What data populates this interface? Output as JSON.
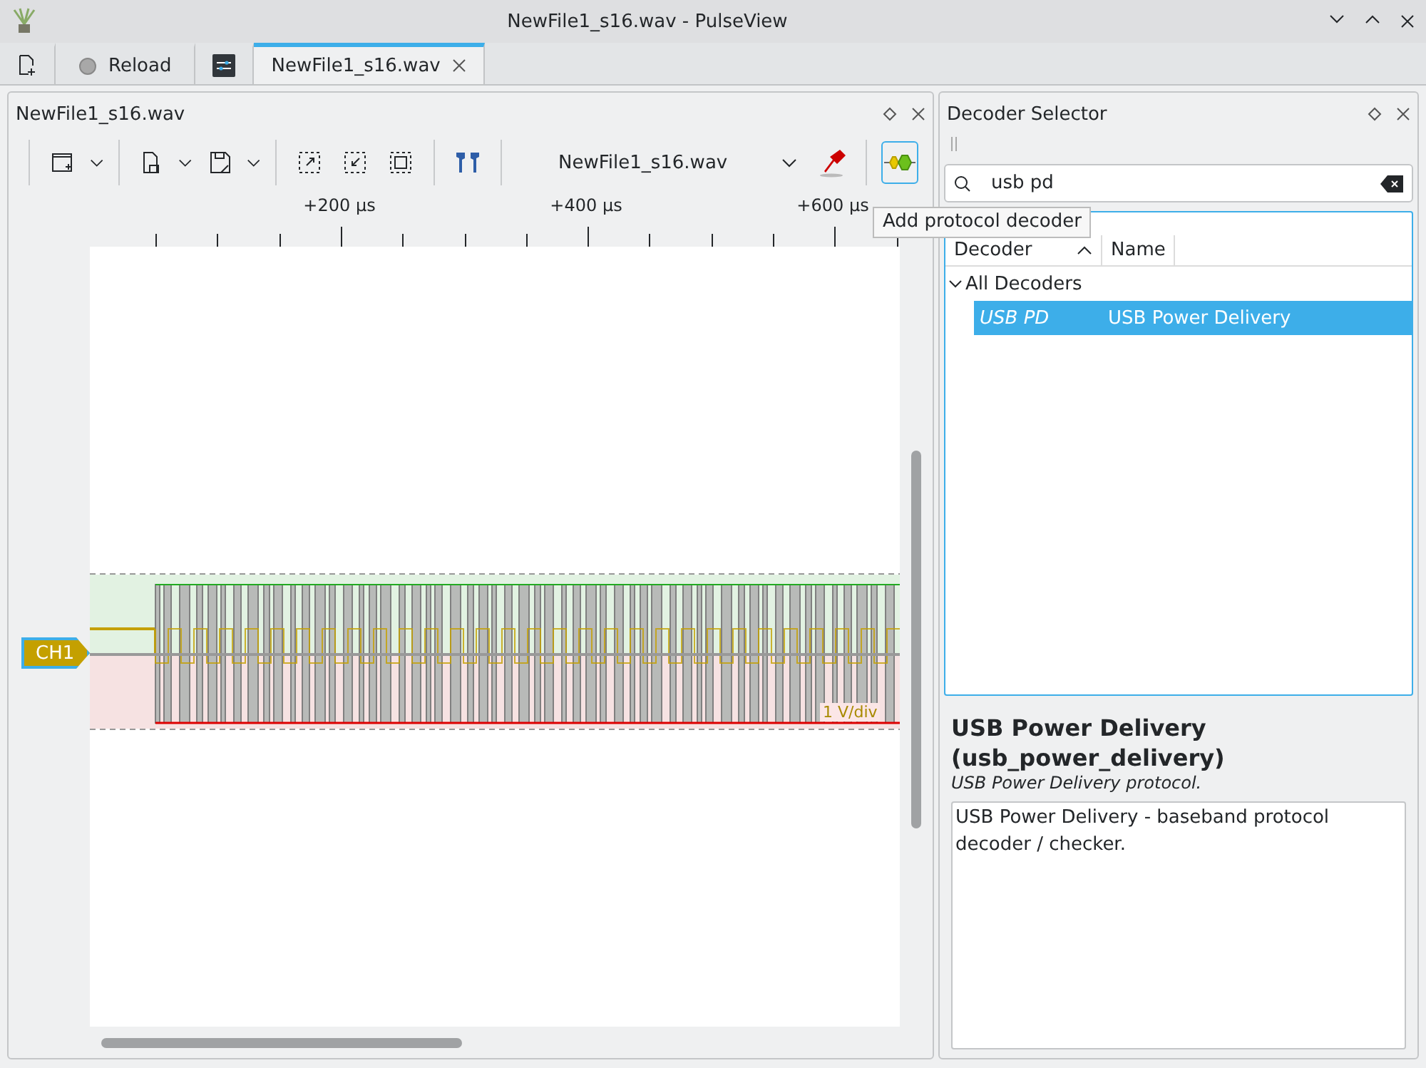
{
  "window": {
    "title": "NewFile1_s16.wav - PulseView"
  },
  "tabs": [
    {
      "kind": "icon",
      "selected": false
    },
    {
      "kind": "reload",
      "label": "Reload",
      "selected": false
    },
    {
      "kind": "settings",
      "selected": false
    },
    {
      "kind": "file",
      "label": "NewFile1_s16.wav",
      "selected": true
    }
  ],
  "session": {
    "title": "NewFile1_s16.wav",
    "device": "NewFile1_s16.wav",
    "tooltip": "Add protocol decoder",
    "ruler": [
      {
        "label": "+200 µs"
      },
      {
        "label": "+400 µs"
      },
      {
        "label": "+600 µs"
      }
    ],
    "channel": {
      "name": "CH1",
      "scale": "1 V/div"
    }
  },
  "decoder_selector": {
    "title": "Decoder Selector",
    "search": "usb pd",
    "columns": [
      {
        "label": "Decoder",
        "sorted": true
      },
      {
        "label": "Name",
        "sorted": false
      }
    ],
    "groups": [
      {
        "label": "All Decoders",
        "expanded": true,
        "children": [
          {
            "id": "USB PD",
            "name": "USB Power Delivery",
            "selected": true
          }
        ]
      }
    ],
    "detail": {
      "title": "USB Power Delivery (usb_power_delivery)",
      "summary": "USB Power Delivery protocol.",
      "description": "USB Power Delivery - baseband protocol decoder / checker."
    }
  }
}
